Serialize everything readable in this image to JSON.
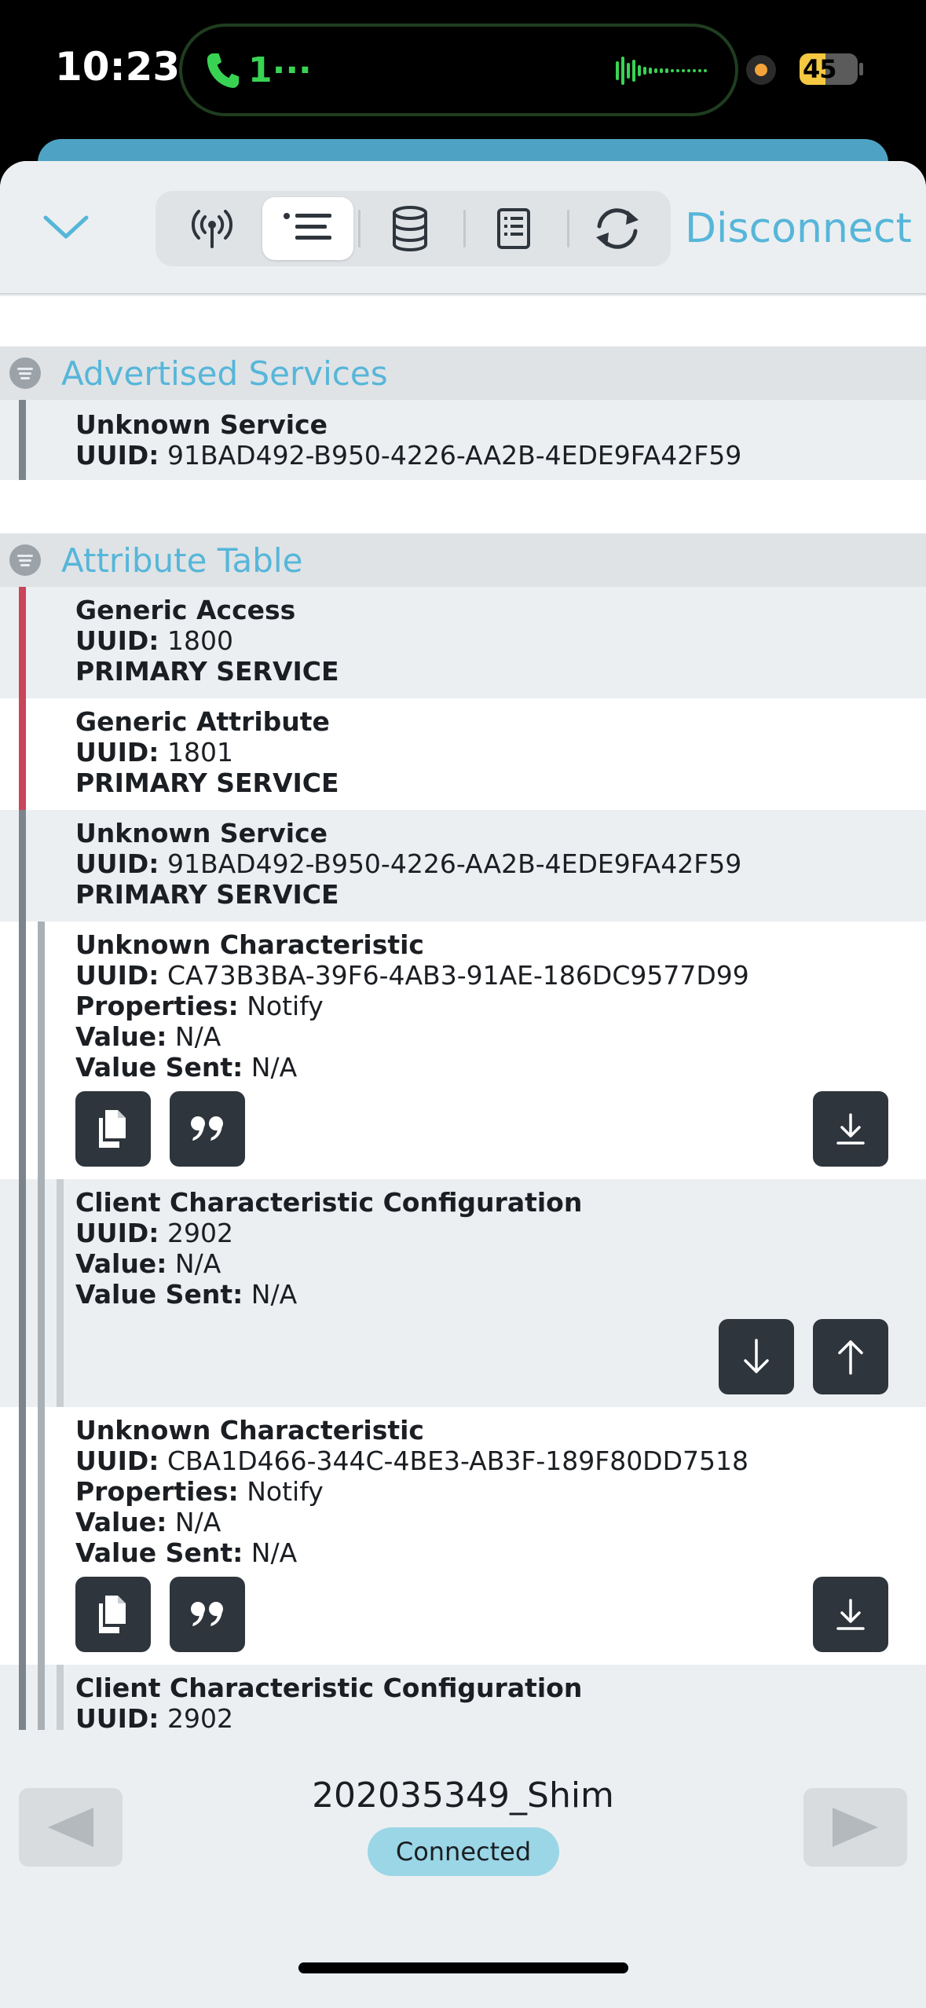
{
  "status_bar": {
    "time": "10:23",
    "call_text": "1···",
    "battery_percent": 45,
    "battery_label": "45"
  },
  "toolbar": {
    "disconnect_label": "Disconnect",
    "tabs": [
      "advertisement-tab",
      "services-list-tab",
      "database-tab",
      "log-tab",
      "refresh-tab"
    ],
    "active_tab": "services-list-tab"
  },
  "advertised": {
    "title": "Advertised Services",
    "service": {
      "name": "Unknown Service",
      "uuid_key": "UUID:",
      "uuid": "91BAD492-B950-4226-AA2B-4EDE9FA42F59"
    }
  },
  "attribute_table": {
    "title": "Attribute Table",
    "generic_access": {
      "name": "Generic Access",
      "uuid_key": "UUID:",
      "uuid": "1800",
      "type": "PRIMARY SERVICE"
    },
    "generic_attribute": {
      "name": "Generic Attribute",
      "uuid_key": "UUID:",
      "uuid": "1801",
      "type": "PRIMARY SERVICE"
    },
    "unknown_service": {
      "name": "Unknown Service",
      "uuid_key": "UUID:",
      "uuid": "91BAD492-B950-4226-AA2B-4EDE9FA42F59",
      "type": "PRIMARY SERVICE"
    },
    "char1": {
      "name": "Unknown Characteristic",
      "uuid_key": "UUID:",
      "uuid": "CA73B3BA-39F6-4AB3-91AE-186DC9577D99",
      "props_key": "Properties:",
      "props": "Notify",
      "value_key": "Value:",
      "value": "N/A",
      "sent_key": "Value Sent:",
      "sent": "N/A"
    },
    "desc1": {
      "name": "Client Characteristic Configuration",
      "uuid_key": "UUID:",
      "uuid": "2902",
      "value_key": "Value:",
      "value": "N/A",
      "sent_key": "Value Sent:",
      "sent": "N/A"
    },
    "char2": {
      "name": "Unknown Characteristic",
      "uuid_key": "UUID:",
      "uuid": "CBA1D466-344C-4BE3-AB3F-189F80DD7518",
      "props_key": "Properties:",
      "props": "Notify",
      "value_key": "Value:",
      "value": "N/A",
      "sent_key": "Value Sent:",
      "sent": "N/A"
    },
    "desc2": {
      "name": "Client Characteristic Configuration",
      "uuid_key": "UUID:",
      "uuid": "2902"
    }
  },
  "footer": {
    "device_name": "202035349_Shim",
    "status": "Connected"
  },
  "colors": {
    "accent": "#56b6d9",
    "service_bar_red": "#c8455a",
    "service_bar_gray": "#7c858e",
    "char_bar": "#a9b0b6",
    "desc_bar": "#c9ced2",
    "button_dark": "#2e353c"
  }
}
